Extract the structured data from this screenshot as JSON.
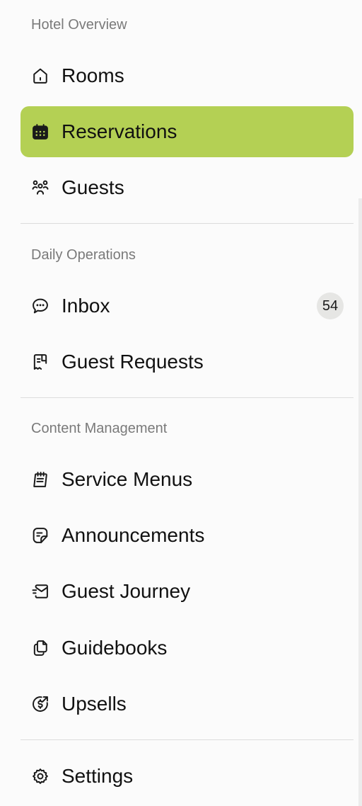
{
  "sections": {
    "hotel_overview": "Hotel Overview",
    "daily_operations": "Daily Operations",
    "content_management": "Content Management"
  },
  "nav": {
    "rooms": {
      "label": "Rooms",
      "icon": "home-icon"
    },
    "reservations": {
      "label": "Reservations",
      "icon": "calendar-icon",
      "active": true
    },
    "guests": {
      "label": "Guests",
      "icon": "users-icon"
    },
    "inbox": {
      "label": "Inbox",
      "icon": "chat-icon",
      "badge": "54"
    },
    "guest_requests": {
      "label": "Guest Requests",
      "icon": "receipt-icon"
    },
    "service_menus": {
      "label": "Service Menus",
      "icon": "notepad-icon"
    },
    "announcements": {
      "label": "Announcements",
      "icon": "note-icon"
    },
    "guest_journey": {
      "label": "Guest Journey",
      "icon": "mail-fast-icon"
    },
    "guidebooks": {
      "label": "Guidebooks",
      "icon": "documents-icon"
    },
    "upsells": {
      "label": "Upsells",
      "icon": "dollar-circle-icon"
    },
    "settings": {
      "label": "Settings",
      "icon": "gear-icon"
    }
  },
  "colors": {
    "active_background": "#b4d054",
    "badge_background": "#e6e6e4",
    "section_label": "#7a7a7a",
    "divider": "#dcdcdc"
  }
}
